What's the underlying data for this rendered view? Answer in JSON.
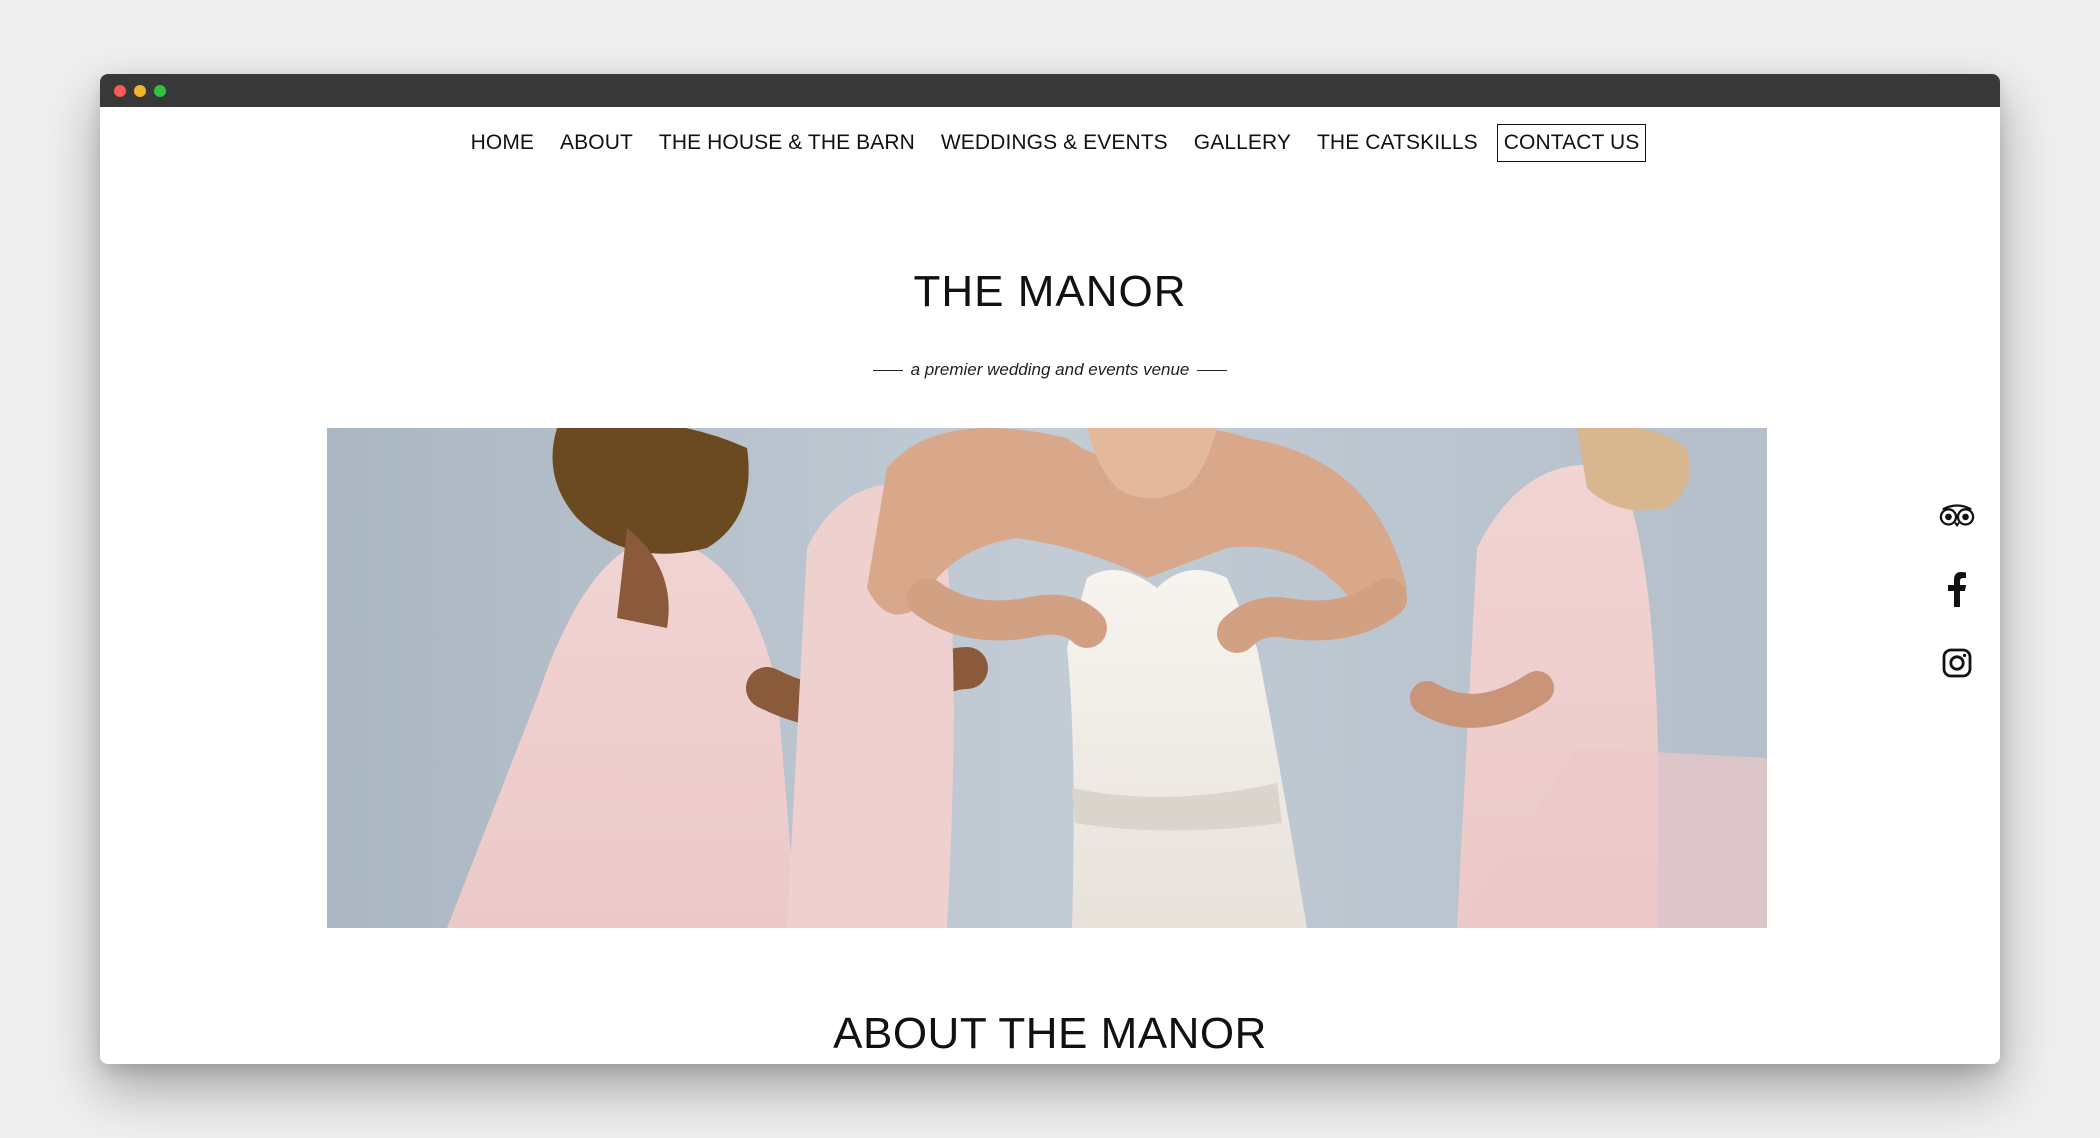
{
  "nav": {
    "items": [
      {
        "label": "HOME"
      },
      {
        "label": "ABOUT"
      },
      {
        "label": "THE HOUSE & THE BARN"
      },
      {
        "label": "WEDDINGS & EVENTS"
      },
      {
        "label": "GALLERY"
      },
      {
        "label": "THE CATSKILLS"
      },
      {
        "label": "CONTACT US"
      }
    ]
  },
  "hero": {
    "title": "THE MANOR",
    "subtitle": "a premier wedding and events venue"
  },
  "about": {
    "title": "ABOUT THE MANOR"
  },
  "social": {
    "icons": [
      "tripadvisor-icon",
      "facebook-icon",
      "instagram-icon"
    ]
  },
  "colors": {
    "titlebar": "#383838",
    "text": "#111111",
    "background": "#ffffff"
  }
}
